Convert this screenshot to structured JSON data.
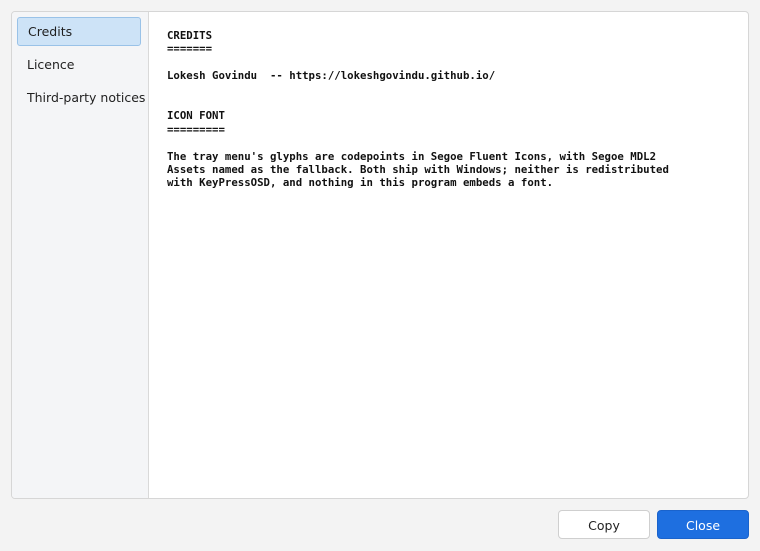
{
  "sidebar": {
    "items": [
      {
        "label": "Credits",
        "selected": true
      },
      {
        "label": "Licence",
        "selected": false
      },
      {
        "label": "Third-party notices",
        "selected": false
      }
    ]
  },
  "content": {
    "text": "CREDITS\n=======\n\nLokesh Govindu  -- https://lokeshgovindu.github.io/\n\n\nICON FONT\n=========\n\nThe tray menu's glyphs are codepoints in Segoe Fluent Icons, with Segoe MDL2\nAssets named as the fallback. Both ship with Windows; neither is redistributed\nwith KeyPressOSD, and nothing in this program embeds a font."
  },
  "buttons": {
    "copy_label": "Copy",
    "close_label": "Close"
  },
  "colors": {
    "accent": "#1e6fe0",
    "selection": "#cde3f7"
  }
}
